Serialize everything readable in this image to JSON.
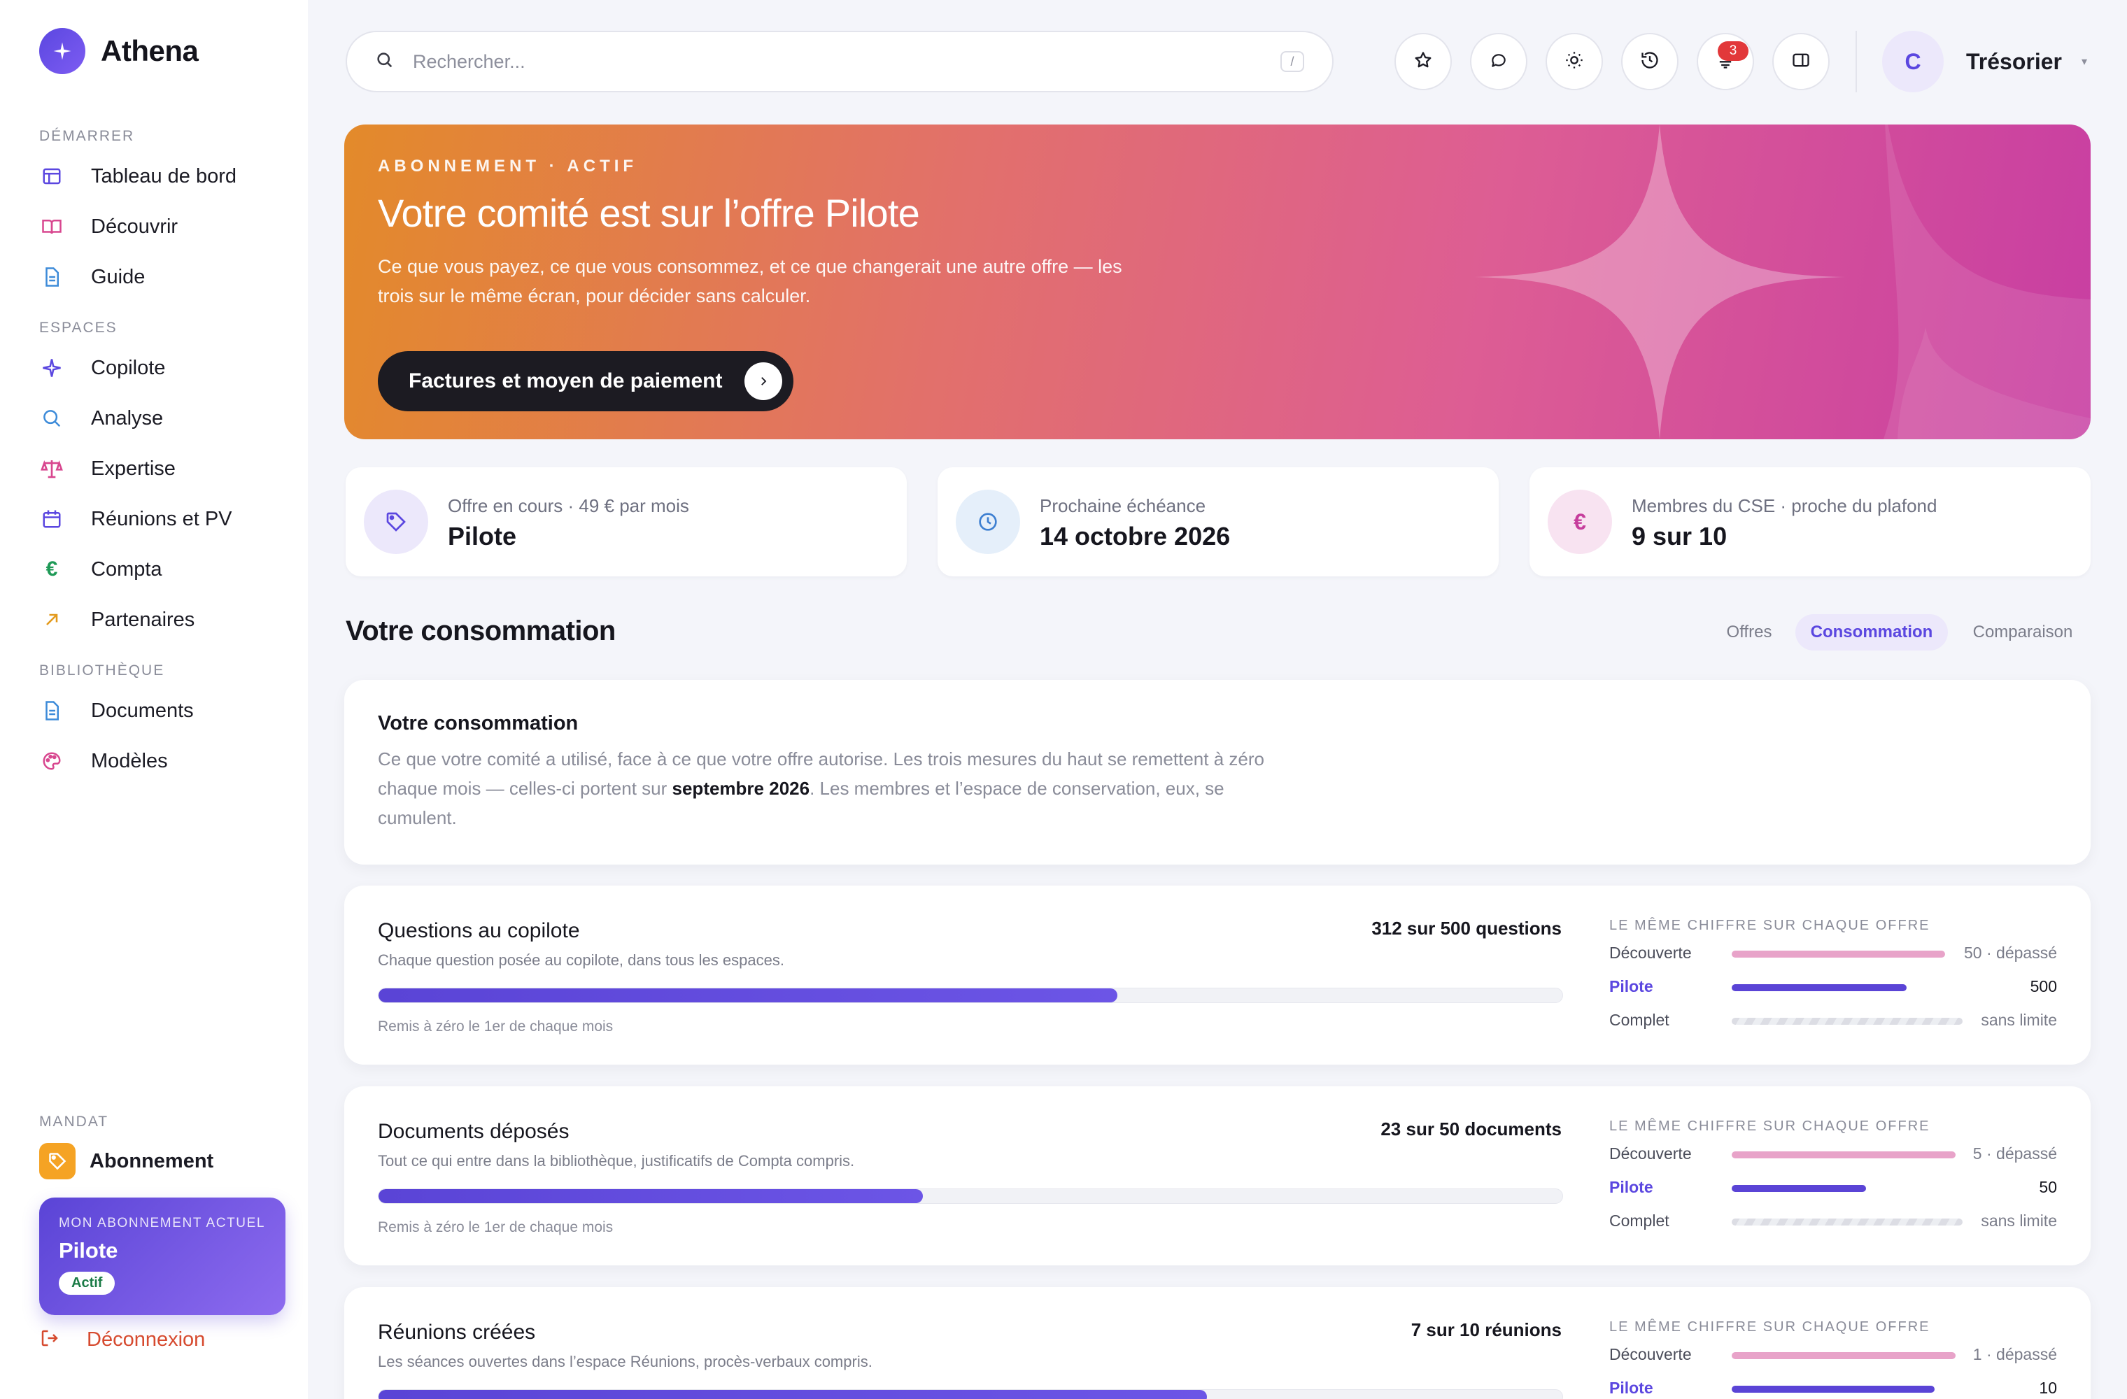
{
  "brand": {
    "name": "Athena"
  },
  "sidebar": {
    "sections": [
      {
        "label": "Démarrer",
        "items": [
          {
            "label": "Tableau de bord",
            "icon": "layout-icon"
          },
          {
            "label": "Découvrir",
            "icon": "book-icon"
          },
          {
            "label": "Guide",
            "icon": "document-icon"
          }
        ]
      },
      {
        "label": "Espaces",
        "items": [
          {
            "label": "Copilote",
            "icon": "sparkle-icon"
          },
          {
            "label": "Analyse",
            "icon": "search-icon"
          },
          {
            "label": "Expertise",
            "icon": "scale-icon"
          },
          {
            "label": "Réunions et PV",
            "icon": "calendar-icon"
          },
          {
            "label": "Compta",
            "icon": "euro-icon"
          },
          {
            "label": "Partenaires",
            "icon": "arrow-up-right-icon"
          }
        ]
      },
      {
        "label": "Bibliothèque",
        "items": [
          {
            "label": "Documents",
            "icon": "document-icon"
          },
          {
            "label": "Modèles",
            "icon": "palette-icon"
          }
        ]
      }
    ],
    "mandat": {
      "label": "Mandat",
      "item": {
        "label": "Abonnement",
        "icon": "tag-icon"
      }
    },
    "plan_card": {
      "kicker": "Mon abonnement actuel",
      "name": "Pilote",
      "badge": "Actif"
    },
    "logout": "Déconnexion"
  },
  "topbar": {
    "search_placeholder": "Rechercher...",
    "search_shortcut": "/",
    "notifications_count": "3",
    "user": {
      "initial": "C",
      "name": "Trésorier"
    }
  },
  "hero": {
    "kicker": "Abonnement · Actif",
    "title": "Votre comité est sur l’offre Pilote",
    "subtitle": "Ce que vous payez, ce que vous consommez, et ce que changerait une autre offre — les trois sur le même écran, pour décider sans calculer.",
    "button": "Factures et moyen de paiement"
  },
  "stats": [
    {
      "label": "Offre en cours · 49 € par mois",
      "value": "Pilote",
      "icon": "tag-icon",
      "color": "#ece8fb",
      "icon_color": "#5b47e0"
    },
    {
      "label": "Prochaine échéance",
      "value": "14 octobre 2026",
      "icon": "clock-icon",
      "color": "#e5effa",
      "icon_color": "#3d7fd1"
    },
    {
      "label": "Membres du CSE · proche du plafond",
      "value": "9 sur 10",
      "icon": "euro-icon",
      "color": "#f8e3f1",
      "icon_color": "#c63d9c"
    }
  ],
  "consumption": {
    "title": "Votre consommation",
    "tabs": [
      {
        "label": "Offres",
        "active": false
      },
      {
        "label": "Consommation",
        "active": true
      },
      {
        "label": "Comparaison",
        "active": false
      }
    ],
    "intro": {
      "title": "Votre consommation",
      "body_pre": "Ce que votre comité a utilisé, face à ce que votre offre autorise. Les trois mesures du haut se remettent à zéro chaque mois — celles-ci portent sur ",
      "body_bold": "septembre 2026",
      "body_post": ". Les membres et l’espace de conservation, eux, se cumulent."
    },
    "compare_header": "Le même chiffre sur chaque offre",
    "metrics": [
      {
        "title": "Questions au copilote",
        "description": "Chaque question posée au copilote, dans tous les espaces.",
        "count": "312 sur 500 questions",
        "used": 312,
        "limit": 500,
        "reset": "Remis à zéro le 1er de chaque mois",
        "compare": [
          {
            "plan": "Découverte",
            "value": "50 · dépassé",
            "fill": 1.0
          },
          {
            "plan": "Pilote",
            "value": "500",
            "fill": 0.75,
            "current": true
          },
          {
            "plan": "Complet",
            "value": "sans limite",
            "fill": 1.0,
            "unlimited": true
          }
        ]
      },
      {
        "title": "Documents déposés",
        "description": "Tout ce qui entre dans la bibliothèque, justificatifs de Compta compris.",
        "count": "23 sur 50 documents",
        "used": 23,
        "limit": 50,
        "reset": "Remis à zéro le 1er de chaque mois",
        "compare": [
          {
            "plan": "Découverte",
            "value": "5 · dépassé",
            "fill": 1.0
          },
          {
            "plan": "Pilote",
            "value": "50",
            "fill": 0.6,
            "current": true
          },
          {
            "plan": "Complet",
            "value": "sans limite",
            "fill": 1.0,
            "unlimited": true
          }
        ]
      },
      {
        "title": "Réunions créées",
        "description": "Les séances ouvertes dans l’espace Réunions, procès-verbaux compris.",
        "count": "7 sur 10 réunions",
        "used": 7,
        "limit": 10,
        "reset": "",
        "compare": [
          {
            "plan": "Découverte",
            "value": "1 · dépassé",
            "fill": 1.0
          },
          {
            "plan": "Pilote",
            "value": "10",
            "fill": 0.9,
            "current": true
          }
        ]
      }
    ]
  }
}
